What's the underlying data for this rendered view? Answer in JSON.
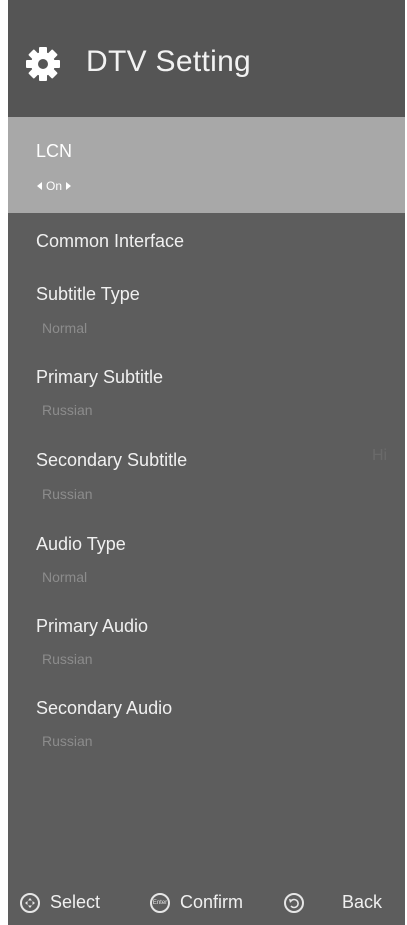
{
  "header": {
    "title": "DTV Setting",
    "icon": "gear-icon"
  },
  "items": [
    {
      "label": "LCN",
      "value": "On"
    },
    {
      "label": "Common Interface"
    },
    {
      "label": "Subtitle Type",
      "value": "Normal"
    },
    {
      "label": "Primary Subtitle",
      "value": "Russian"
    },
    {
      "label": "Secondary Subtitle",
      "value": "Russian"
    },
    {
      "label": "Audio Type",
      "value": "Normal"
    },
    {
      "label": "Primary Audio",
      "value": "Russian"
    },
    {
      "label": "Secondary Audio",
      "value": "Russian"
    }
  ],
  "ghost_text": "Hi",
  "footer": {
    "select_label": "Select",
    "confirm_label": "Confirm",
    "enter_icon_text": "Enter",
    "back_label": "Back"
  },
  "colors": {
    "panel": "#5d5d5d",
    "selected": "#a8a8a8",
    "value_text": "#8c8c8c"
  }
}
